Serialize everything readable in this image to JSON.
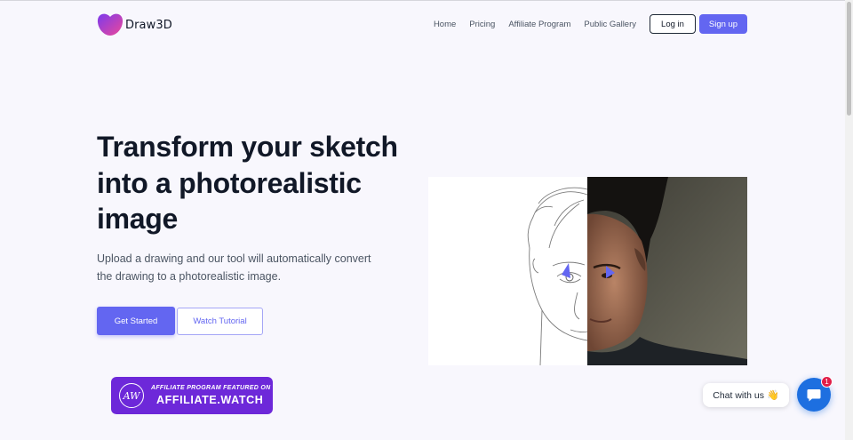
{
  "brand": {
    "name": "Draw3D",
    "accent": "#6366f1"
  },
  "nav": {
    "links": [
      "Home",
      "Pricing",
      "Affiliate Program",
      "Public Gallery"
    ],
    "login_label": "Log in",
    "signup_label": "Sign up"
  },
  "hero": {
    "title": "Transform your sketch into a photorealistic image",
    "subtitle": "Upload a drawing and our tool will automatically convert the drawing to a photorealistic image.",
    "primary_cta": "Get Started",
    "secondary_cta": "Watch Tutorial",
    "image_icon": "sketch-to-photo-comparison"
  },
  "affiliate_badge": {
    "logo_text": "AW",
    "caption": "AFFILIATE PROGRAM FEATURED ON",
    "site": "AFFILIATE.WATCH",
    "color": "#6d28d9"
  },
  "chat": {
    "prompt": "Chat with us",
    "emoji": "👋",
    "unread_count": "1",
    "launcher_color": "#1d6fe0"
  }
}
